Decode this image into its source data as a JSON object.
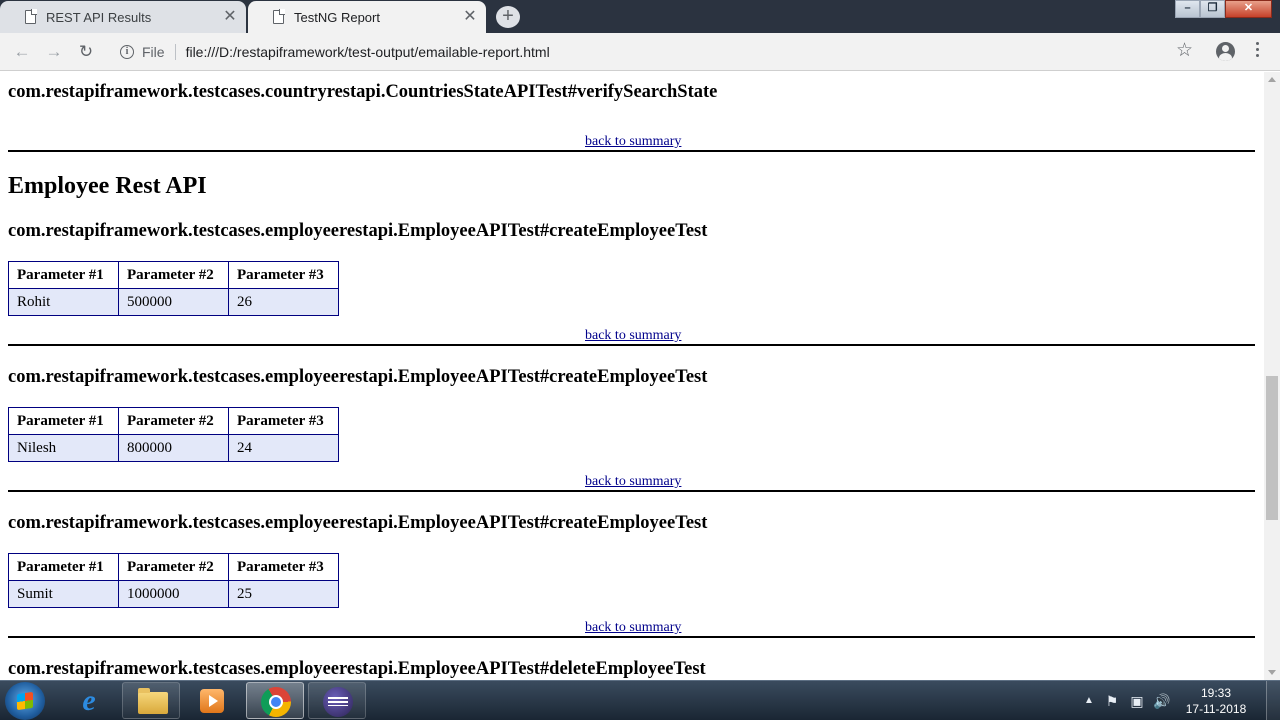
{
  "browser": {
    "tabs": [
      {
        "title": "REST API Results",
        "active": false
      },
      {
        "title": "TestNG Report",
        "active": true
      }
    ],
    "address": {
      "chip": "File",
      "url": "file:///D:/restapiframework/test-output/emailable-report.html"
    }
  },
  "report": {
    "back_link": "back to summary",
    "top_method": "com.restapiframework.testcases.countryrestapi.CountriesStateAPITest#verifySearchState",
    "group_title": "Employee Rest API",
    "param_headers": [
      "Parameter #1",
      "Parameter #2",
      "Parameter #3"
    ],
    "methods": [
      {
        "name": "com.restapiframework.testcases.employeerestapi.EmployeeAPITest#createEmployeeTest",
        "params": [
          "Rohit",
          "500000",
          "26"
        ]
      },
      {
        "name": "com.restapiframework.testcases.employeerestapi.EmployeeAPITest#createEmployeeTest",
        "params": [
          "Nilesh",
          "800000",
          "24"
        ]
      },
      {
        "name": "com.restapiframework.testcases.employeerestapi.EmployeeAPITest#createEmployeeTest",
        "params": [
          "Sumit",
          "1000000",
          "25"
        ]
      },
      {
        "name": "com.restapiframework.testcases.employeerestapi.EmployeeAPITest#deleteEmployeeTest"
      }
    ]
  },
  "taskbar": {
    "apps": [
      "internet-explorer-icon",
      "file-explorer-icon",
      "media-player-icon",
      "chrome-icon",
      "eclipse-icon"
    ],
    "active_app": "chrome-icon",
    "clock_time": "19:33",
    "clock_date": "17-11-2018"
  },
  "colors": {
    "link": "#00008b",
    "param_cell_bg": "#e3e8f9",
    "param_border": "#000080"
  }
}
